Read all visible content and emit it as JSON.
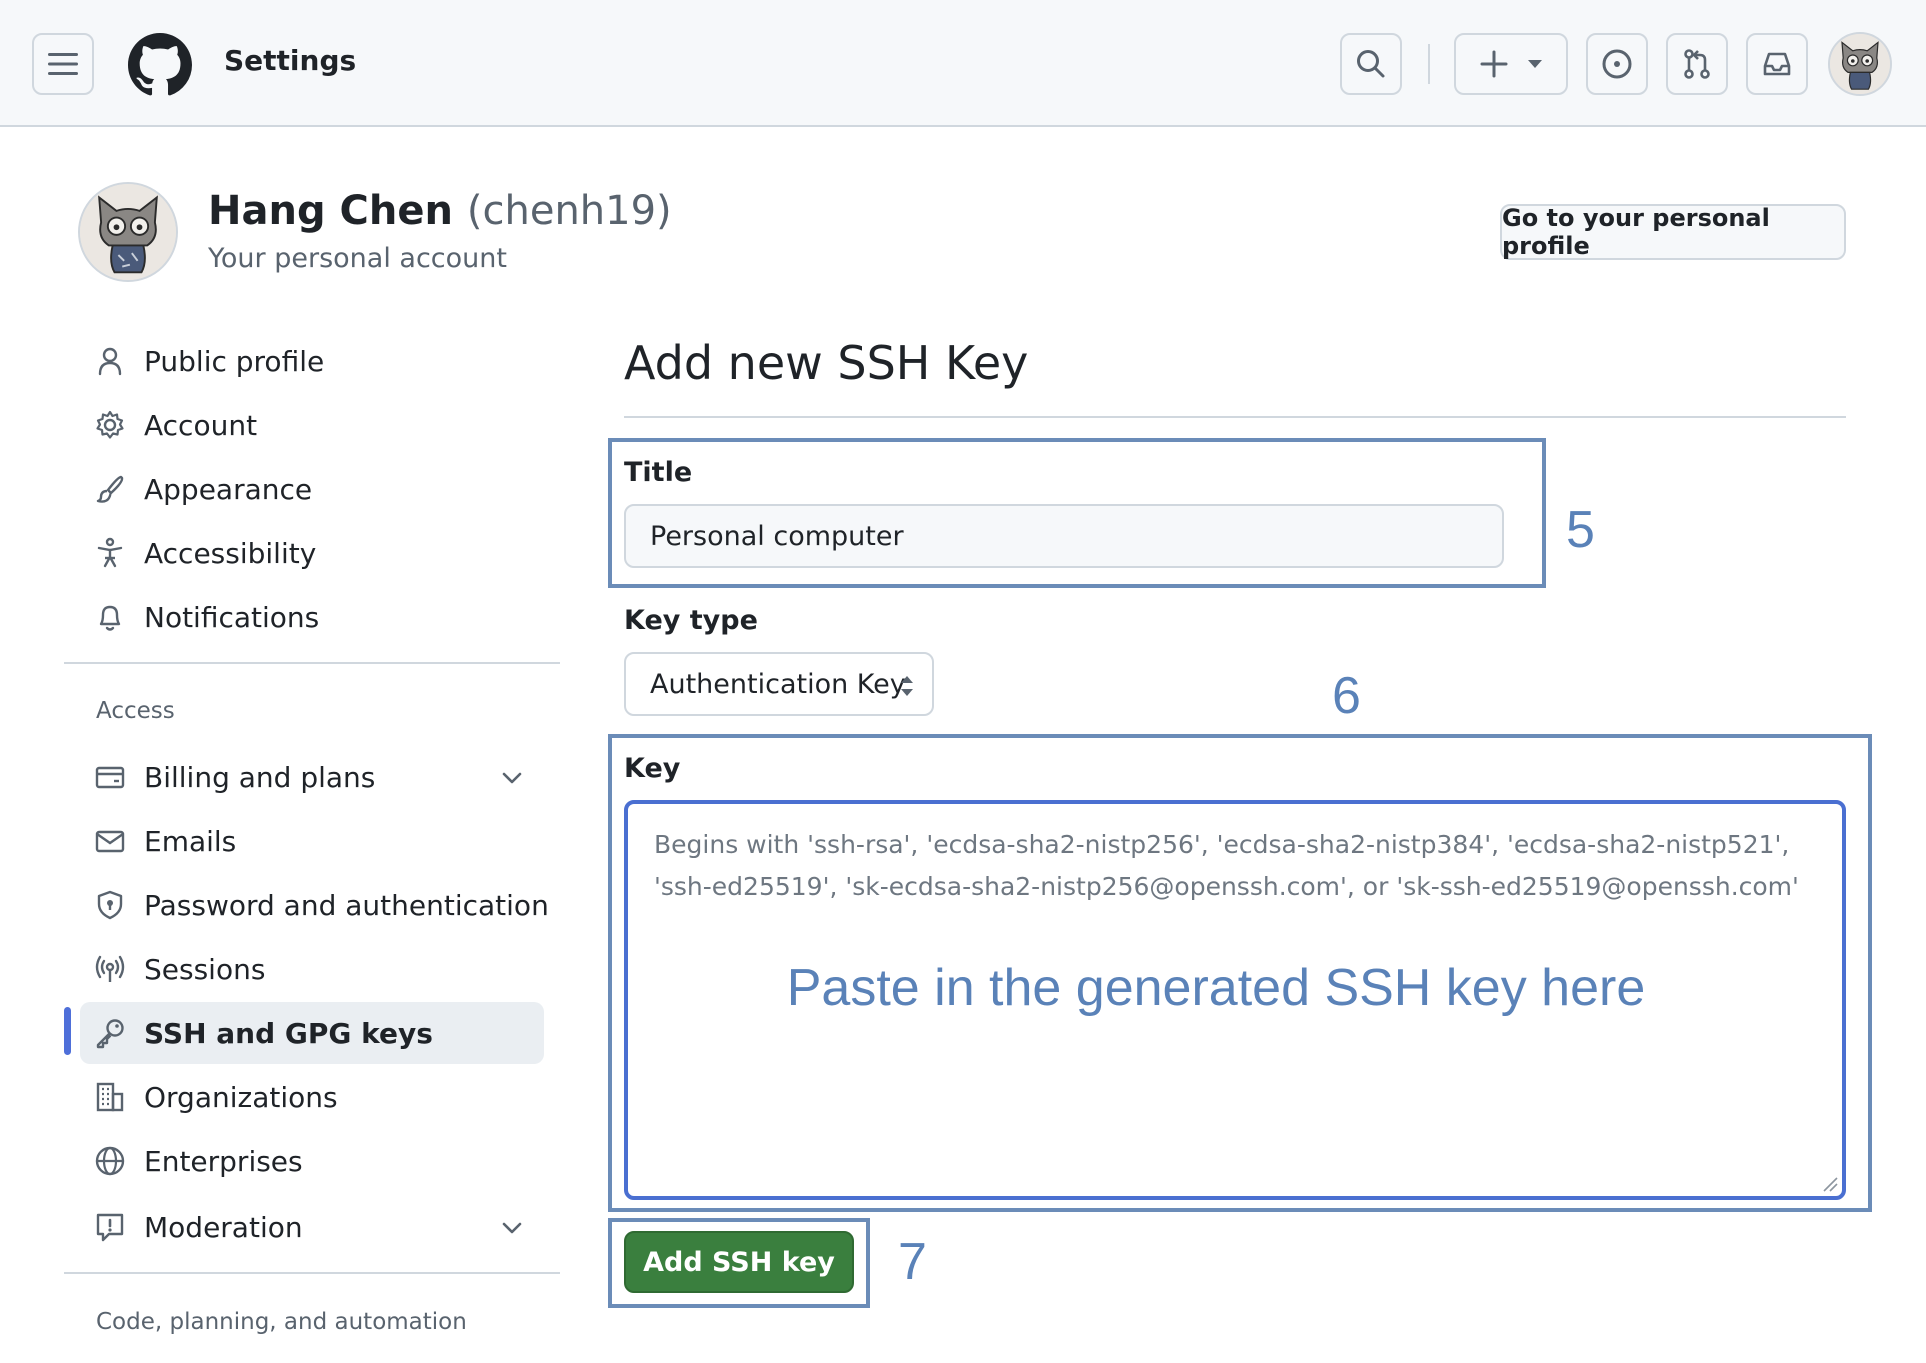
{
  "header": {
    "title": "Settings",
    "menu_icon": "hamburger-menu-icon",
    "logo_icon": "github-logo-icon",
    "search_icon": "search-icon",
    "create_icon": "plus-icon",
    "issues_icon": "issue-opened-icon",
    "pulls_icon": "git-pull-request-icon",
    "inbox_icon": "inbox-icon"
  },
  "profile": {
    "name": "Hang Chen",
    "login": "(chenh19)",
    "subtitle": "Your personal account",
    "go_to_profile_label": "Go to your personal profile"
  },
  "sidebar": {
    "items": [
      {
        "label": "Public profile",
        "icon": "person-icon"
      },
      {
        "label": "Account",
        "icon": "gear-icon"
      },
      {
        "label": "Appearance",
        "icon": "paintbrush-icon"
      },
      {
        "label": "Accessibility",
        "icon": "accessibility-icon"
      },
      {
        "label": "Notifications",
        "icon": "bell-icon"
      }
    ],
    "access_heading": "Access",
    "access_items": [
      {
        "label": "Billing and plans",
        "icon": "credit-card-icon",
        "expandable": true
      },
      {
        "label": "Emails",
        "icon": "mail-icon"
      },
      {
        "label": "Password and authentication",
        "icon": "shield-lock-icon"
      },
      {
        "label": "Sessions",
        "icon": "broadcast-icon"
      },
      {
        "label": "SSH and GPG keys",
        "icon": "key-icon",
        "active": true
      },
      {
        "label": "Organizations",
        "icon": "organization-icon"
      },
      {
        "label": "Enterprises",
        "icon": "globe-icon"
      },
      {
        "label": "Moderation",
        "icon": "report-icon",
        "expandable": true
      }
    ],
    "code_heading": "Code, planning, and automation"
  },
  "form": {
    "page_title": "Add new SSH Key",
    "title_label": "Title",
    "title_value": "Personal computer",
    "key_type_label": "Key type",
    "key_type_value": "Authentication Key",
    "key_label": "Key",
    "key_placeholder": "Begins with 'ssh-rsa', 'ecdsa-sha2-nistp256', 'ecdsa-sha2-nistp384', 'ecdsa-sha2-nistp521', 'ssh-ed25519', 'sk-ecdsa-sha2-nistp256@openssh.com', or 'sk-ssh-ed25519@openssh.com'",
    "submit_label": "Add SSH key"
  },
  "annotations": {
    "step_title": "5",
    "step_key": "6",
    "step_submit": "7",
    "key_note": "Paste in the generated SSH key here"
  },
  "colors": {
    "accent": "#4a6fd1",
    "primary_button": "#3a7f3e",
    "annotation": "#5a82b8"
  }
}
